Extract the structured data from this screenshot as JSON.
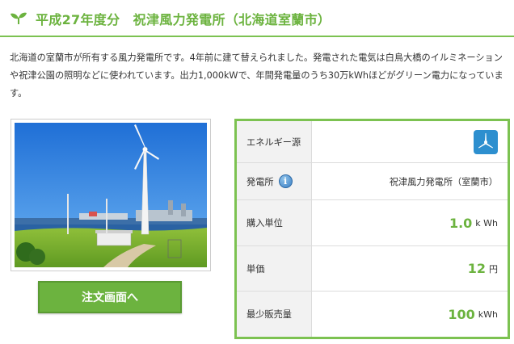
{
  "header": {
    "title": "平成27年度分　祝津風力発電所（北海道室蘭市）",
    "icon": "sprout-icon",
    "accent_color": "#6cb33f"
  },
  "description": "北海道の室蘭市が所有する風力発電所です。4年前に建て替えられました。発電された電気は白鳥大橋のイルミネーションや祝津公園の照明などに使われています。出力1,000kWで、年間発電量のうち30万kWhほどがグリーン電力になっています。",
  "order_button": {
    "label": "注文画面へ"
  },
  "table": {
    "energy_source": {
      "label": "エネルギー源",
      "icon": "wind-turbine-icon"
    },
    "plant": {
      "label": "発電所",
      "icon": "info-icon",
      "value": "祝津風力発電所（室蘭市）"
    },
    "purchase_unit": {
      "label": "購入単位",
      "value": "1.0",
      "unit": "k Wh"
    },
    "unit_price": {
      "label": "単価",
      "value": "12",
      "unit": "円"
    },
    "min_sales": {
      "label": "最少販売量",
      "value": "100",
      "unit": "kWh"
    }
  }
}
